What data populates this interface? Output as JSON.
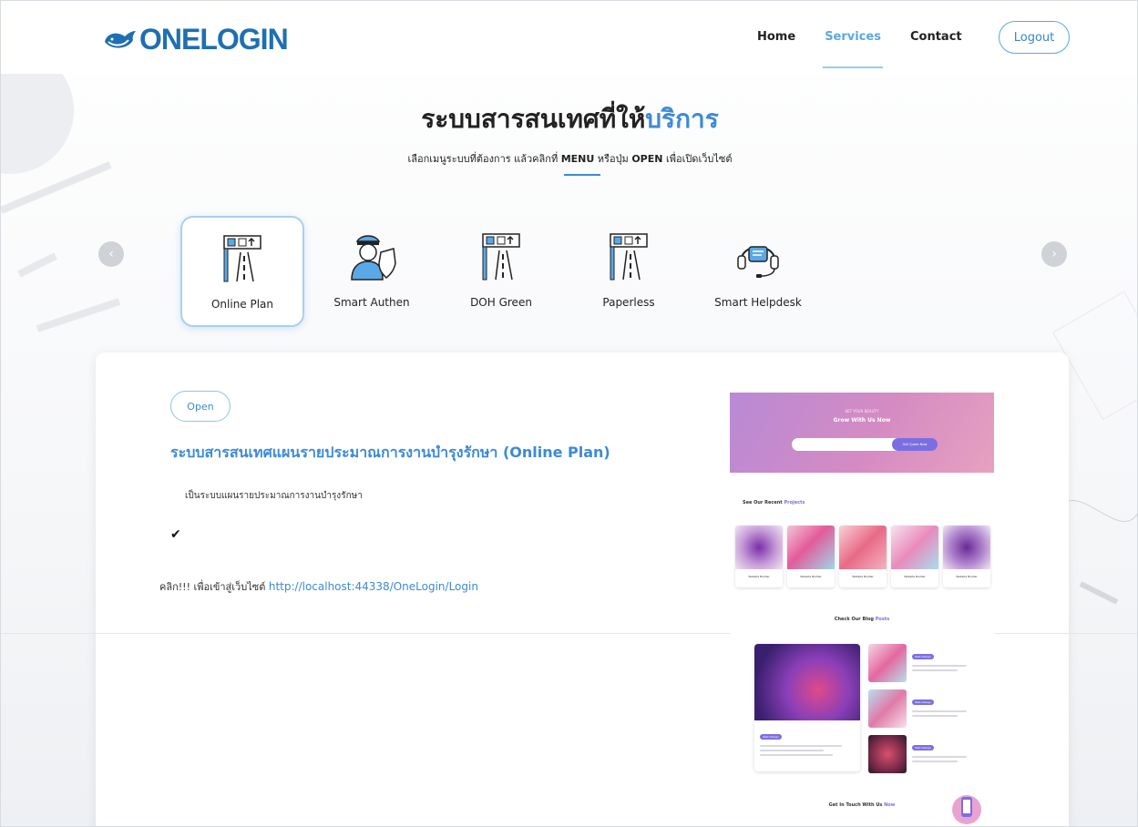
{
  "header": {
    "logo": "ONELOGIN",
    "nav": [
      {
        "label": "Home",
        "active": false
      },
      {
        "label": "Services",
        "active": true
      },
      {
        "label": "Contact",
        "active": false
      }
    ],
    "logout_label": "Logout"
  },
  "hero": {
    "title_main": "ระบบสารสนเทศที่ให้",
    "title_accent": "บริการ",
    "subtitle_pre": "เลือกเมนูระบบที่ต้องการ แล้วคลิกที่ ",
    "subtitle_menu": "MENU",
    "subtitle_mid": " หรือปุ่ม ",
    "subtitle_open": "OPEN",
    "subtitle_post": " เพื่อเปิดเว็บไซต์"
  },
  "carousel": {
    "prev_icon": "chevron-left-icon",
    "next_icon": "chevron-right-icon",
    "items": [
      {
        "label": "Online Plan",
        "icon": "road-sign-icon",
        "selected": true
      },
      {
        "label": "Smart Authen",
        "icon": "security-guard-icon",
        "selected": false
      },
      {
        "label": "DOH Green",
        "icon": "road-sign-icon",
        "selected": false
      },
      {
        "label": "Paperless",
        "icon": "road-sign-icon",
        "selected": false
      },
      {
        "label": "Smart Helpdesk",
        "icon": "headset-icon",
        "selected": false
      }
    ]
  },
  "detail": {
    "open_label": "Open",
    "title": "ระบบสารสนเทศแผนรายประมาณการงานบำรุงรักษา (Online Plan)",
    "description": "เป็นระบบแผนรายประมาณการงานบำรุงรักษา",
    "check": "✔",
    "link_prefix": "คลิก!!! เพื่อเข้าสู่เว็บไซต์ ",
    "link_url": "http://localhost:44338/OneLogin/Login"
  },
  "preview": {
    "hero_small": "SET YOUR BEAUTY",
    "hero_title": "Grow With Us Now",
    "search_button": "Get Quote Now",
    "projects_label": "See Our Recent ",
    "projects_highlight": "Projects",
    "thumb_caption": "Website Builder",
    "blog_label": "Check Our Blog ",
    "blog_highlight": "Posts",
    "post_tag": "Web Design",
    "contact_label": "Get In Touch With Us ",
    "contact_highlight": "Now"
  },
  "colors": {
    "accent": "#3d8ad6",
    "nav_active": "#5aa8e6",
    "logo": "#1f6fb2"
  }
}
